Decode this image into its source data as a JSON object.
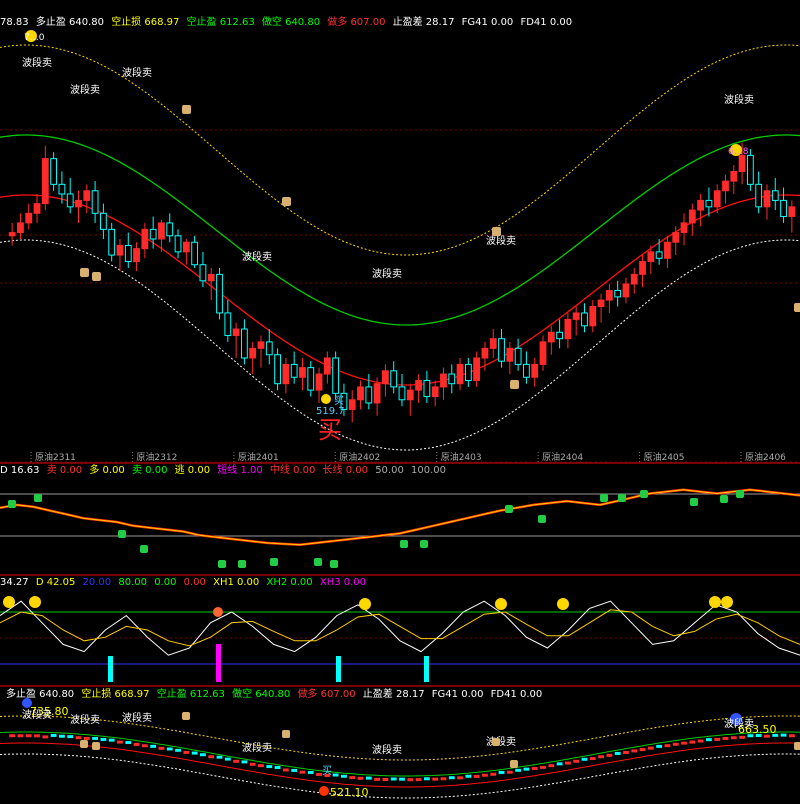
{
  "colors": {
    "bg": "#000000",
    "candle_up": "#ff2a2a",
    "candle_down": "#00ffff",
    "mid_band": "#00cc00",
    "low_band": "#ff1010",
    "outer_band_top": "#ffd700",
    "outer_band_bottom": "#ffffff",
    "separator": "#a00000"
  },
  "header_main": [
    {
      "label": "78.83",
      "color": "#ffffff"
    },
    {
      "label": "多止盈 640.80",
      "color": "#ffffff"
    },
    {
      "label": "空止损 668.97",
      "color": "#ffff00"
    },
    {
      "label": "空止盈 612.63",
      "color": "#00ff00"
    },
    {
      "label": "做空 640.80",
      "color": "#00ff00"
    },
    {
      "label": "做多 607.00",
      "color": "#ff3030"
    },
    {
      "label": "止盈差 28.17",
      "color": "#ffffff"
    },
    {
      "label": "FG41 0.00",
      "color": "#ffffff"
    },
    {
      "label": "FD41 0.00",
      "color": "#ffffff"
    }
  ],
  "header_bottom": [
    {
      "label": "多止盈 640.80",
      "color": "#ffffff"
    },
    {
      "label": "空止损 668.97",
      "color": "#ffff00"
    },
    {
      "label": "空止盈 612.63",
      "color": "#00ff00"
    },
    {
      "label": "做空 640.80",
      "color": "#00ff00"
    },
    {
      "label": "做多 607.00",
      "color": "#ff3030"
    },
    {
      "label": "止盈差 28.17",
      "color": "#ffffff"
    },
    {
      "label": "FG41 0.00",
      "color": "#ffffff"
    },
    {
      "label": "FD41 0.00",
      "color": "#ffffff"
    }
  ],
  "header_panel2": [
    {
      "label": "D 16.63",
      "color": "#ffffff"
    },
    {
      "label": "卖 0.00",
      "color": "#ff3030"
    },
    {
      "label": "多 0.00",
      "color": "#ffff00"
    },
    {
      "label": "卖 0.00",
      "color": "#00ff00"
    },
    {
      "label": "逃 0.00",
      "color": "#ffff00"
    },
    {
      "label": "短线 1.00",
      "color": "#ff00ff"
    },
    {
      "label": "中线 0.00",
      "color": "#ff3030"
    },
    {
      "label": "长线 0.00",
      "color": "#ff3030"
    },
    {
      "label": "50.00",
      "color": "#aaaaaa"
    },
    {
      "label": "100.00",
      "color": "#aaaaaa"
    }
  ],
  "header_panel3": [
    {
      "label": "34.27",
      "color": "#ffffff"
    },
    {
      "label": "D 42.05",
      "color": "#ffff00"
    },
    {
      "label": "20.00",
      "color": "#3333ff"
    },
    {
      "label": "80.00",
      "color": "#00ff00"
    },
    {
      "label": "0.00",
      "color": "#00ff00"
    },
    {
      "label": "0.00",
      "color": "#ff3030"
    },
    {
      "label": "XH1 0.00",
      "color": "#ffff00"
    },
    {
      "label": "XH2 0.00",
      "color": "#00ff00"
    },
    {
      "label": "XH3 0.00",
      "color": "#ff00ff"
    }
  ],
  "main_labels": {
    "top_marker": "7…0",
    "low_price": "519.7",
    "low_tag": "买",
    "peak_tag": "6…8",
    "wave_sell": "波段卖",
    "low_glyph": "买"
  },
  "bottom_labels": {
    "high_price": "735.80",
    "right_price": "663.50",
    "low_price": "521.10",
    "wave_sell": "波段卖",
    "low_tag": "买"
  },
  "chart_data": [
    {
      "type": "line",
      "name": "main",
      "x_ticks": [
        "原油2311",
        "原油2312",
        "原油2401",
        "原油2402",
        "原油2403",
        "原油2404",
        "原油2405",
        "原油2406"
      ],
      "candles": [
        [
          632,
          640,
          626,
          634
        ],
        [
          634,
          646,
          630,
          640
        ],
        [
          640,
          652,
          636,
          646
        ],
        [
          646,
          658,
          640,
          652
        ],
        [
          652,
          688,
          648,
          680
        ],
        [
          680,
          684,
          660,
          664
        ],
        [
          664,
          672,
          652,
          658
        ],
        [
          658,
          668,
          646,
          650
        ],
        [
          650,
          660,
          640,
          654
        ],
        [
          654,
          664,
          646,
          660
        ],
        [
          660,
          666,
          640,
          646
        ],
        [
          646,
          652,
          630,
          636
        ],
        [
          636,
          640,
          616,
          620
        ],
        [
          620,
          630,
          610,
          626
        ],
        [
          626,
          634,
          612,
          616
        ],
        [
          616,
          628,
          610,
          624
        ],
        [
          624,
          640,
          618,
          636
        ],
        [
          636,
          644,
          624,
          630
        ],
        [
          630,
          642,
          622,
          640
        ],
        [
          640,
          646,
          628,
          632
        ],
        [
          632,
          636,
          618,
          622
        ],
        [
          622,
          630,
          614,
          628
        ],
        [
          628,
          632,
          612,
          614
        ],
        [
          614,
          622,
          600,
          604
        ],
        [
          604,
          612,
          592,
          608
        ],
        [
          608,
          612,
          580,
          584
        ],
        [
          584,
          592,
          566,
          570
        ],
        [
          570,
          578,
          556,
          574
        ],
        [
          574,
          580,
          552,
          556
        ],
        [
          556,
          566,
          546,
          562
        ],
        [
          562,
          570,
          550,
          566
        ],
        [
          566,
          574,
          552,
          558
        ],
        [
          558,
          562,
          536,
          540
        ],
        [
          540,
          556,
          534,
          552
        ],
        [
          552,
          560,
          540,
          544
        ],
        [
          544,
          556,
          536,
          550
        ],
        [
          550,
          554,
          532,
          536
        ],
        [
          536,
          550,
          528,
          546
        ],
        [
          546,
          560,
          540,
          556
        ],
        [
          556,
          560,
          530,
          534
        ],
        [
          534,
          540,
          520,
          524
        ],
        [
          524,
          536,
          516,
          530
        ],
        [
          530,
          542,
          524,
          538
        ],
        [
          538,
          546,
          524,
          528
        ],
        [
          528,
          544,
          520,
          540
        ],
        [
          540,
          552,
          532,
          548
        ],
        [
          548,
          554,
          534,
          538
        ],
        [
          538,
          546,
          526,
          530
        ],
        [
          530,
          540,
          520,
          536
        ],
        [
          536,
          546,
          528,
          542
        ],
        [
          542,
          548,
          528,
          532
        ],
        [
          532,
          542,
          526,
          538
        ],
        [
          538,
          550,
          530,
          546
        ],
        [
          546,
          552,
          534,
          540
        ],
        [
          540,
          556,
          536,
          552
        ],
        [
          552,
          556,
          538,
          542
        ],
        [
          542,
          560,
          538,
          556
        ],
        [
          556,
          566,
          548,
          562
        ],
        [
          562,
          574,
          556,
          568
        ],
        [
          568,
          574,
          550,
          554
        ],
        [
          554,
          566,
          546,
          562
        ],
        [
          562,
          568,
          548,
          552
        ],
        [
          552,
          560,
          540,
          544
        ],
        [
          544,
          556,
          538,
          552
        ],
        [
          552,
          570,
          548,
          566
        ],
        [
          566,
          576,
          558,
          572
        ],
        [
          572,
          580,
          562,
          568
        ],
        [
          568,
          584,
          562,
          580
        ],
        [
          580,
          588,
          570,
          584
        ],
        [
          584,
          590,
          572,
          576
        ],
        [
          576,
          592,
          572,
          588
        ],
        [
          588,
          596,
          578,
          592
        ],
        [
          592,
          602,
          584,
          598
        ],
        [
          598,
          604,
          588,
          594
        ],
        [
          594,
          606,
          590,
          602
        ],
        [
          602,
          612,
          596,
          608
        ],
        [
          608,
          620,
          600,
          616
        ],
        [
          616,
          626,
          608,
          622
        ],
        [
          622,
          630,
          614,
          618
        ],
        [
          618,
          632,
          612,
          628
        ],
        [
          628,
          638,
          620,
          634
        ],
        [
          634,
          646,
          626,
          640
        ],
        [
          640,
          652,
          632,
          648
        ],
        [
          648,
          658,
          638,
          654
        ],
        [
          654,
          662,
          644,
          650
        ],
        [
          650,
          664,
          646,
          660
        ],
        [
          660,
          670,
          652,
          666
        ],
        [
          666,
          676,
          658,
          672
        ],
        [
          672,
          690,
          664,
          682
        ],
        [
          682,
          686,
          660,
          664
        ],
        [
          664,
          672,
          646,
          650
        ],
        [
          650,
          664,
          642,
          660
        ],
        [
          660,
          668,
          648,
          654
        ],
        [
          654,
          662,
          640,
          644
        ],
        [
          644,
          654,
          634,
          650
        ]
      ],
      "ylim": [
        500,
        760
      ],
      "annotations": [
        "波段卖",
        "519.7",
        "买"
      ]
    },
    {
      "type": "line",
      "name": "panel2",
      "ylim": [
        0,
        100
      ],
      "ref_lines": [
        50,
        100
      ],
      "series": [
        {
          "values": [
            55,
            58,
            56,
            52,
            48,
            44,
            42,
            40,
            36,
            34,
            32,
            30,
            26,
            24,
            22,
            20,
            18,
            17,
            16,
            18,
            20,
            22,
            24,
            26,
            28,
            32,
            36,
            40,
            44,
            48,
            52,
            55,
            58,
            60,
            62,
            60,
            58,
            62,
            66,
            70,
            72,
            74,
            72,
            70,
            72,
            74,
            72,
            70,
            68
          ]
        }
      ]
    },
    {
      "type": "line",
      "name": "panel3",
      "ylim": [
        0,
        100
      ],
      "ref_lines": [
        80,
        20
      ],
      "series": [
        {
          "name": "K",
          "values": [
            70,
            90,
            60,
            30,
            20,
            50,
            70,
            40,
            15,
            25,
            60,
            75,
            55,
            30,
            20,
            40,
            70,
            85,
            65,
            35,
            20,
            45,
            75,
            90,
            70,
            40,
            25,
            50,
            80,
            90,
            60,
            30,
            35,
            60,
            85,
            75,
            45,
            25,
            15
          ]
        },
        {
          "name": "D",
          "values": [
            60,
            75,
            70,
            50,
            35,
            40,
            55,
            50,
            35,
            28,
            40,
            60,
            62,
            48,
            35,
            35,
            50,
            68,
            72,
            55,
            38,
            38,
            55,
            72,
            75,
            58,
            42,
            42,
            60,
            78,
            75,
            55,
            42,
            48,
            65,
            72,
            60,
            42,
            30
          ]
        }
      ]
    },
    {
      "type": "line",
      "name": "bottom",
      "ylim": [
        500,
        760
      ]
    }
  ]
}
